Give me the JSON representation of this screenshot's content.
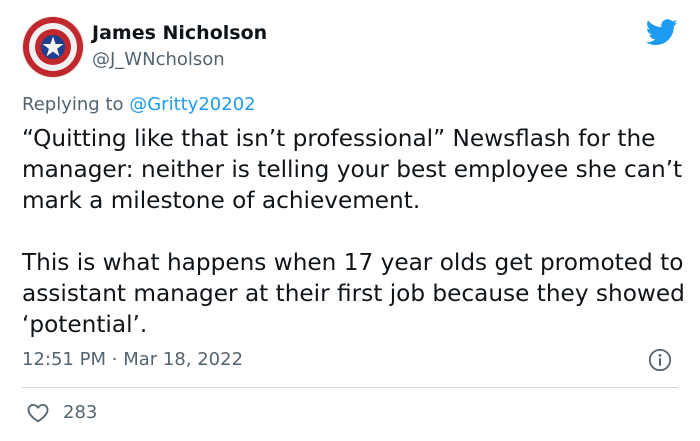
{
  "author": {
    "name": "James Nicholson",
    "handle": "@J_WNcholson"
  },
  "reply": {
    "prefix": "Replying to",
    "target": "@Gritty20202"
  },
  "tweet": {
    "paragraphs": [
      "“Quitting like that isn’t professional” Newsflash for the manager: neither is telling your best employee she can’t mark a milestone of achievement.",
      "This is what happens when 17 year olds get promoted to assistant manager at their first job because they showed ‘potential’."
    ]
  },
  "meta": {
    "time": "12:51 PM",
    "separator": "·",
    "date": "Mar 18, 2022"
  },
  "engagement": {
    "likes": "283"
  },
  "icons": {
    "avatar": "captain-america-shield",
    "brand": "twitter-bird-icon",
    "info": "info-icon",
    "like": "heart-icon"
  },
  "colors": {
    "text": "#0f1419",
    "secondary": "#536471",
    "accent": "#1d9bf0",
    "divider": "#cfd9de"
  }
}
